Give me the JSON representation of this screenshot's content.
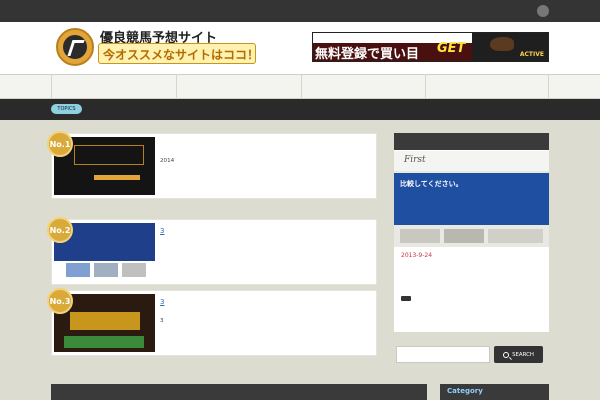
{
  "topbar": {
    "tagline": ""
  },
  "header": {
    "site_title": "優良競馬予想サイト",
    "site_subtitle": "今オススメなサイトはココ！",
    "banner": {
      "top_text": "",
      "main_text": "無料登録で買い目",
      "get_text": "GET",
      "brand": "ACTIVE"
    }
  },
  "nav": {
    "items": [
      "",
      "",
      "",
      ""
    ]
  },
  "ticker": {
    "label": "TOPICS",
    "items": [
      "",
      "",
      ""
    ]
  },
  "posts": [
    {
      "rank": "No.1",
      "title": "",
      "lines": [
        "2014",
        "",
        ""
      ]
    },
    {
      "rank": "No.2",
      "title": "3",
      "lines": [
        "",
        ""
      ]
    },
    {
      "rank": "No.3",
      "title": "3",
      "lines": [
        "3",
        ""
      ]
    }
  ],
  "sidebar": {
    "featured_heading": "",
    "featured": {
      "image_caption": "比較してください。",
      "date": "2013-9-24",
      "category": "",
      "title": "",
      "excerpt": "",
      "more": ""
    },
    "search": {
      "value": "",
      "button": "SEARCH"
    },
    "category_heading": "Category"
  },
  "footer_heading": ""
}
